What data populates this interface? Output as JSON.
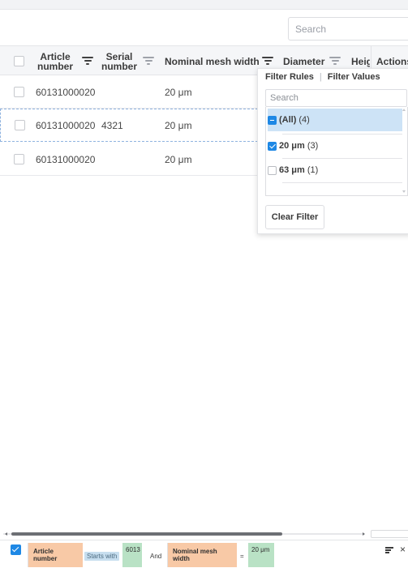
{
  "toolbar": {
    "search_placeholder": "Search"
  },
  "grid": {
    "columns": [
      {
        "line1": "Article",
        "line2": "number"
      },
      {
        "line1": "Serial",
        "line2": "number"
      },
      {
        "label": "Nominal mesh width"
      },
      {
        "label": "Diameter"
      },
      {
        "label": "Heig"
      },
      {
        "label": "Actions"
      }
    ],
    "rows": [
      {
        "article": "60131000020",
        "serial": "",
        "mesh": "20 μm"
      },
      {
        "article": "60131000020",
        "serial": "4321",
        "mesh": "20 μm"
      },
      {
        "article": "60131000020",
        "serial": "",
        "mesh": "20 μm"
      }
    ]
  },
  "filter_popup": {
    "tab_rules": "Filter Rules",
    "tab_values": "Filter Values",
    "search_placeholder": "Search",
    "items": [
      {
        "label": "(All)",
        "count": "(4)",
        "state": "indeterminate"
      },
      {
        "label": "20 μm",
        "count": "(3)",
        "state": "checked"
      },
      {
        "label": "63 μm",
        "count": "(1)",
        "state": "unchecked"
      }
    ],
    "clear_label": "Clear Filter"
  },
  "filter_bar": {
    "enabled": true,
    "field1": "Article number",
    "operator1": "Starts with",
    "value1": "6013",
    "joiner": "And",
    "field2": "Nominal mesh width",
    "operator2": "=",
    "value2": "20 μm"
  },
  "colors": {
    "accent": "#1e88e5",
    "highlight": "#cde3f6",
    "field_chip": "#f8c9a6",
    "operator_chip": "#c7deef",
    "value_chip": "#b9e2c5"
  }
}
